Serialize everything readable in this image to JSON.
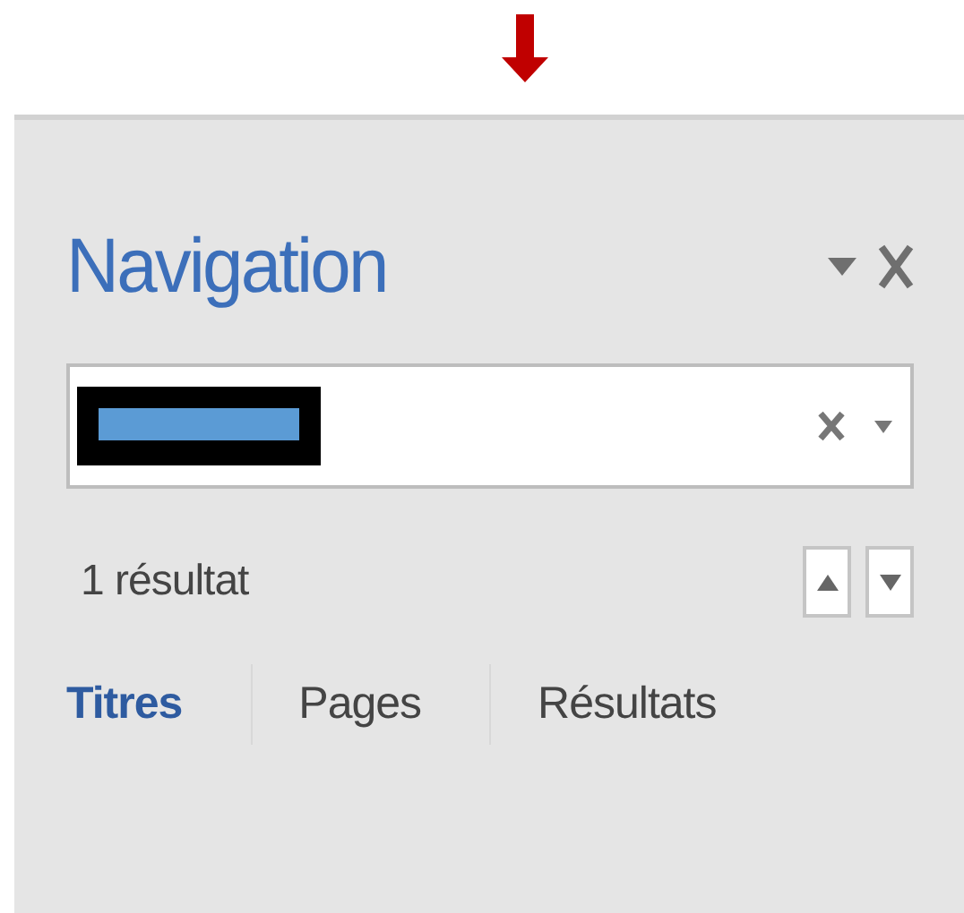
{
  "pane": {
    "title": "Navigation"
  },
  "search": {
    "value_redacted": true
  },
  "results": {
    "count": "1 résultat"
  },
  "tabs": [
    {
      "label": "Titres",
      "selected": true
    },
    {
      "label": "Pages",
      "selected": false
    },
    {
      "label": "Résultats",
      "selected": false
    }
  ]
}
